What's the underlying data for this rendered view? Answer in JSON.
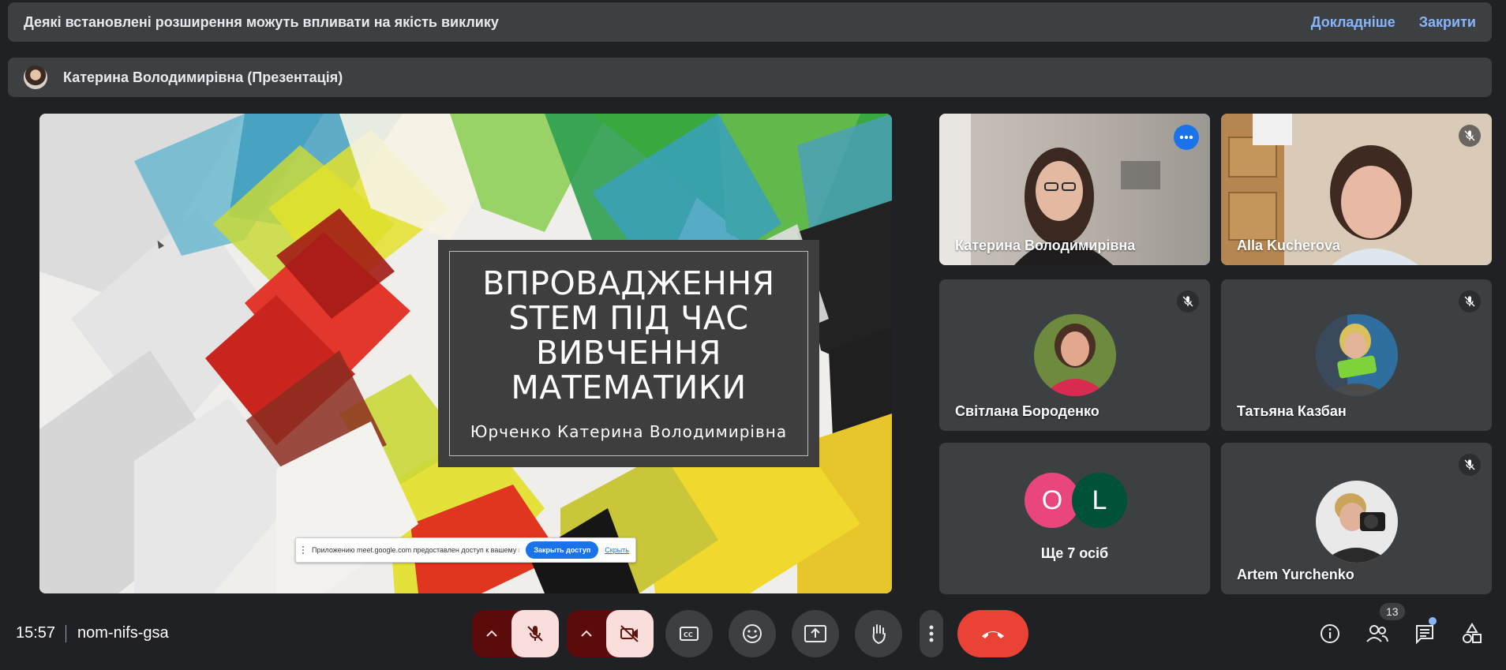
{
  "banner": {
    "text": "Деякі встановлені розширення можуть впливати на якість виклику",
    "details_label": "Докладніше",
    "close_label": "Закрити"
  },
  "presenter_bar": {
    "name": "Катерина Володимирівна (Презентація)"
  },
  "slide": {
    "title_lines": [
      "ВПРОВАДЖЕННЯ",
      "STEM ПІД ЧАС",
      "ВИВЧЕННЯ",
      "МАТЕМАТИКИ"
    ],
    "subtitle": "Юрченко Катерина Володимирівна",
    "share_notice": {
      "text": "Приложению meet.google.com предоставлен доступ к вашему экрану.",
      "stop_label": "Закрыть доступ",
      "hide_label": "Скрыть"
    }
  },
  "participants": [
    {
      "name": "Катерина Володимирівна",
      "muted": false,
      "active": true
    },
    {
      "name": "Alla Kucherova",
      "muted": true,
      "active": false
    },
    {
      "name": "Світлана Бороденко",
      "muted": true,
      "active": false
    },
    {
      "name": "Татьяна Казбан",
      "muted": true,
      "active": false
    },
    {
      "name": "Artem Yurchenko",
      "muted": true,
      "active": false
    }
  ],
  "others": {
    "label": "Ще 7 осіб",
    "avatars": [
      {
        "letter": "O",
        "color": "#e8467c"
      },
      {
        "letter": "L",
        "color": "#00513a"
      }
    ]
  },
  "bottom_bar": {
    "time": "15:57",
    "meeting_code": "nom-nifs-gsa",
    "people_count": "13",
    "icons": {
      "mic": "mic-off-icon",
      "camera": "videocam-off-icon",
      "captions": "closed-caption-icon",
      "reactions": "emoji-icon",
      "present": "present-screen-icon",
      "hand": "raise-hand-icon",
      "more": "more-vert-icon",
      "end": "call-end-icon",
      "info": "info-icon",
      "people": "people-icon",
      "chat": "chat-icon",
      "activities": "activities-icon"
    }
  },
  "colors": {
    "background": "#202124",
    "surface": "#3c4043",
    "accent_blue": "#8ab4f8",
    "end_call_red": "#ea4335",
    "muted_red_bg": "#5c0b0b",
    "muted_pink": "#f9dedc"
  }
}
